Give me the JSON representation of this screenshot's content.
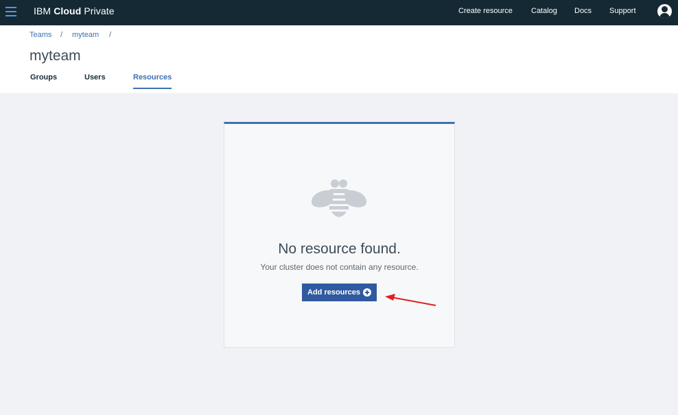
{
  "topbar": {
    "brand_prefix": "IBM ",
    "brand_bold": "Cloud",
    "brand_suffix": " Private",
    "nav": {
      "create_resource": "Create resource",
      "catalog": "Catalog",
      "docs": "Docs",
      "support": "Support"
    },
    "icons": [
      "hamburger-menu-icon",
      "user-avatar-icon"
    ]
  },
  "breadcrumb": {
    "teams": "Teams",
    "myteam": "myteam",
    "separator": "/"
  },
  "page": {
    "title": "myteam"
  },
  "tabs": {
    "groups": "Groups",
    "users": "Users",
    "resources": "Resources",
    "active": "Resources"
  },
  "empty_state": {
    "icon": "bee-icon",
    "title": "No resource found.",
    "description": "Your cluster does not contain any resource.",
    "button_label": "Add resources",
    "button_icon": "plus-circle-icon"
  },
  "annotation": {
    "icon": "red-arrow",
    "color": "#e02020"
  },
  "colors": {
    "topbar": "#152935",
    "accent": "#3d70b2",
    "button": "#2f5aa0",
    "background": "#f0f2f5"
  }
}
